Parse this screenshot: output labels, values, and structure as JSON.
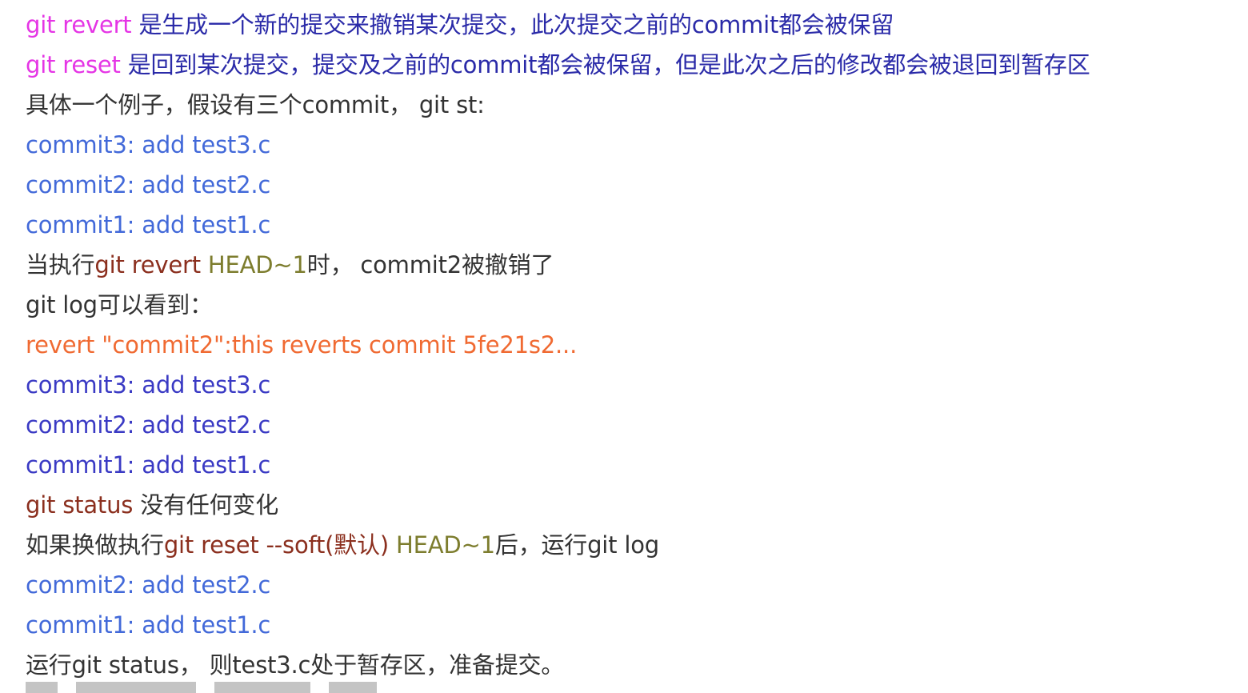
{
  "lines": [
    [
      {
        "text": "git revert",
        "color": "magenta"
      },
      {
        "text": " 是生成一个新的提交来撤销某次提交，此次提交之前的commit都会被保留",
        "color": "navy"
      }
    ],
    [
      {
        "text": "git reset",
        "color": "magenta"
      },
      {
        "text": " 是回到某次提交，提交及之前的commit都会被保留，但是此次之后的修改都会被退回到暂存区",
        "color": "navy"
      }
    ],
    [
      {
        "text": "具体一个例子，假设有三个commit，  git st:",
        "color": "dark"
      }
    ],
    [
      {
        "text": "commit3: add test3.c",
        "color": "blue"
      }
    ],
    [
      {
        "text": "commit2: add test2.c",
        "color": "blue"
      }
    ],
    [
      {
        "text": "commit1: add test1.c",
        "color": "blue"
      }
    ],
    [
      {
        "text": "当执行",
        "color": "dark"
      },
      {
        "text": "git revert",
        "color": "brown"
      },
      {
        "text": " HEAD~1",
        "color": "olive"
      },
      {
        "text": "时，  commit2被撤销了",
        "color": "dark"
      }
    ],
    [
      {
        "text": "git log可以看到：",
        "color": "dark"
      }
    ],
    [
      {
        "text": "revert \"commit2\":this reverts commit 5fe21s2...",
        "color": "orange"
      }
    ],
    [
      {
        "text": "commit3: add test3.c",
        "color": "indigo"
      }
    ],
    [
      {
        "text": "commit2: add test2.c",
        "color": "indigo"
      }
    ],
    [
      {
        "text": "commit1: add test1.c",
        "color": "indigo"
      }
    ],
    [
      {
        "text": "git status",
        "color": "brown"
      },
      {
        "text": " 没有任何变化",
        "color": "dark"
      }
    ],
    [
      {
        "text": "如果换做执行",
        "color": "dark"
      },
      {
        "text": "git reset --soft(默认)",
        "color": "brown"
      },
      {
        "text": " HEAD~1",
        "color": "olive"
      },
      {
        "text": "后，运行git log",
        "color": "dark"
      }
    ],
    [
      {
        "text": "commit2: add test2.c",
        "color": "blue"
      }
    ],
    [
      {
        "text": "commit1: add test1.c",
        "color": "blue"
      }
    ],
    [
      {
        "text": "运行git status，  则test3.c处于暂存区，准备提交。",
        "color": "dark"
      }
    ]
  ],
  "colors": {
    "magenta": "#e535e5",
    "navy": "#2a2aa8",
    "dark": "#333333",
    "blue": "#4269d9",
    "indigo": "#3a3ac4",
    "brown": "#8b2f1e",
    "olive": "#7d7d2e",
    "orange": "#f06a32"
  }
}
